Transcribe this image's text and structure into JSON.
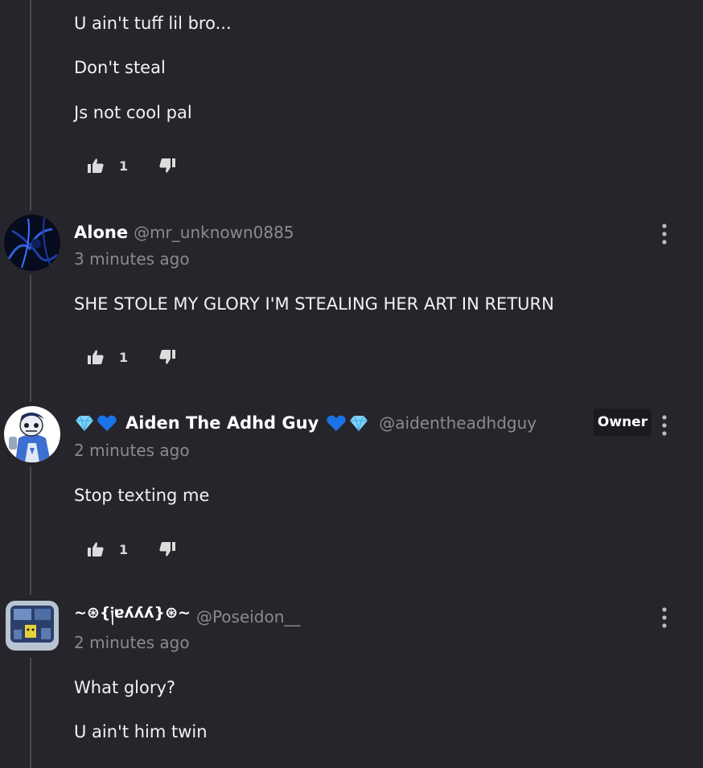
{
  "comments": [
    {
      "lines": [
        "U ain't tuff lil bro...",
        "Don't steal",
        "Js not cool pal"
      ],
      "likes": "1"
    },
    {
      "name": "Alone",
      "handle": "@mr_unknown0885",
      "time": "3 minutes ago",
      "text": "SHE STOLE MY GLORY I'M STEALING HER ART IN RETURN",
      "likes": "1"
    },
    {
      "name": "Aiden The Adhd Guy",
      "handle": "@aidentheadhdguy",
      "time": "2 minutes ago",
      "badge": "Owner",
      "text": "Stop texting me",
      "likes": "1"
    },
    {
      "name": "~⊛{༏ɐʎʎʎ}⊛~",
      "handle": "@Poseidon__",
      "time": "2 minutes ago",
      "lines": [
        "What glory?",
        "U ain't him twin"
      ]
    }
  ],
  "colors": {
    "background": "#26252b",
    "thread_line": "#4a4950",
    "muted_text": "#8a8a90",
    "badge_bg": "#1b1b1f",
    "heart_blue": "#1a73e8",
    "gem_cyan": "#7fd3f7"
  },
  "icons": [
    "thumbs-up-icon",
    "thumbs-down-icon",
    "more-vertical-icon",
    "blue-heart-emoji",
    "gem-emoji"
  ]
}
